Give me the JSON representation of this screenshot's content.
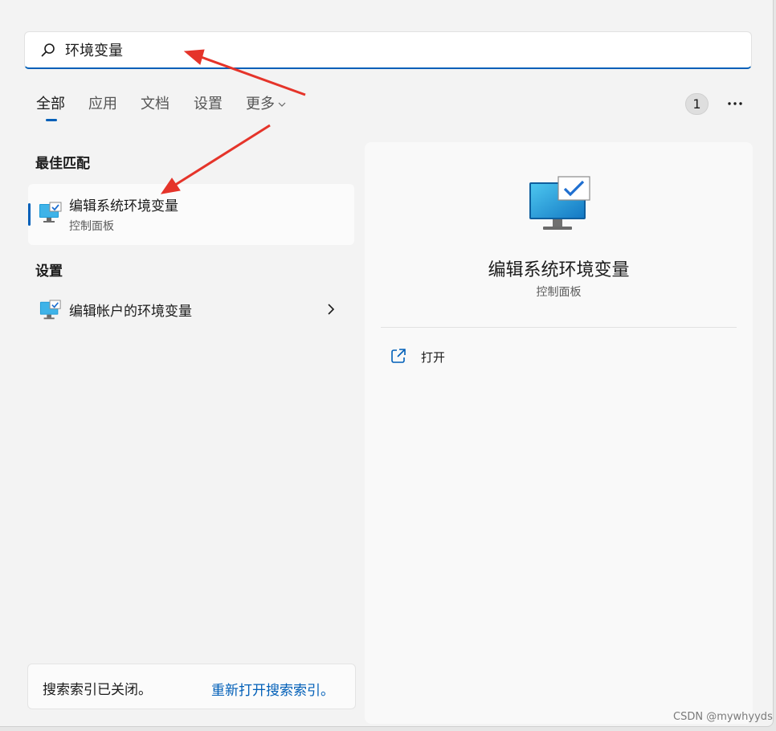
{
  "search": {
    "value": "环境变量",
    "icon": "search-icon"
  },
  "tabs": [
    {
      "label": "全部",
      "active": true
    },
    {
      "label": "应用",
      "active": false
    },
    {
      "label": "文档",
      "active": false
    },
    {
      "label": "设置",
      "active": false
    },
    {
      "label": "更多",
      "active": false
    }
  ],
  "header_right": {
    "count": "1",
    "more_icon": "more-options-icon"
  },
  "best_match": {
    "section_title": "最佳匹配",
    "item": {
      "title": "编辑系统环境变量",
      "subtitle": "控制面板",
      "icon": "monitor-check-icon"
    }
  },
  "settings": {
    "section_title": "设置",
    "item": {
      "label": "编辑帐户的环境变量",
      "icon": "monitor-check-icon",
      "arrow_icon": "chevron-right-icon"
    }
  },
  "index_notice": {
    "text": "搜索索引已关闭。",
    "link": "重新打开搜索索引。"
  },
  "detail": {
    "title": "编辑系统环境变量",
    "subtitle": "控制面板",
    "icon": "monitor-check-icon",
    "actions": [
      {
        "label": "打开",
        "icon": "open-external-icon"
      }
    ]
  },
  "watermark": "CSDN @mywhyyds",
  "colors": {
    "accent": "#005fb8",
    "annotation_arrow": "#e5342a",
    "background": "#f3f3f3"
  }
}
